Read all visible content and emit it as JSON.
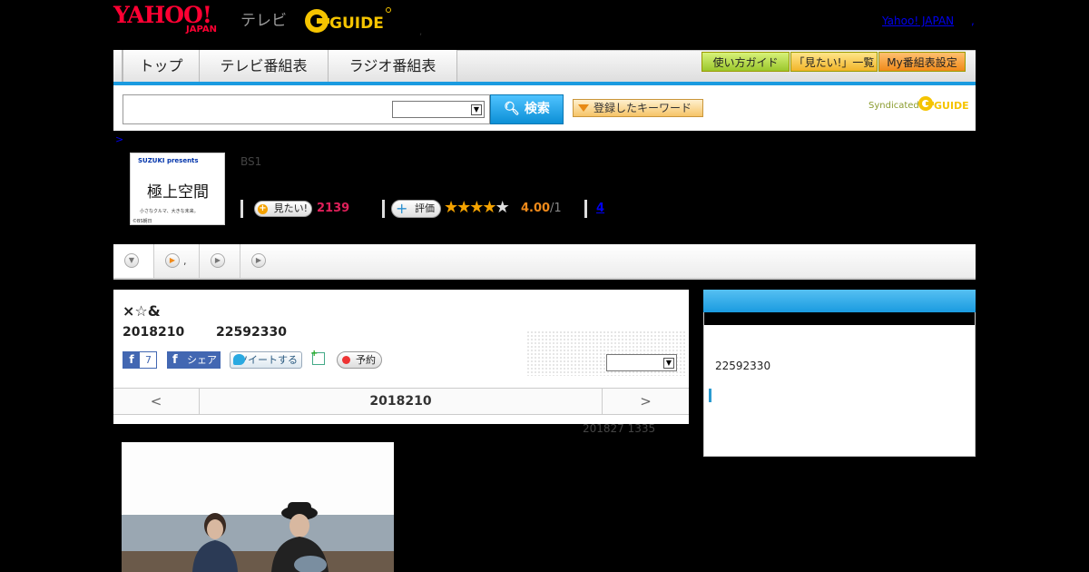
{
  "header": {
    "logo_yahoo": "YAHOO!",
    "logo_japan": "JAPAN",
    "logo_tv": "テレビ",
    "logo_gguide": "G GUIDE",
    "dot": ",",
    "yahoo_japan_link": "Yahoo! JAPAN",
    "sep": ","
  },
  "nav": {
    "tabs": [
      {
        "label": "トップ"
      },
      {
        "label": "テレビ番組表"
      },
      {
        "label": "ラジオ番組表"
      }
    ],
    "guide_buttons": [
      {
        "label": "使い方ガイド"
      },
      {
        "label": "「見たい!」一覧"
      },
      {
        "label": "My番組表設定"
      }
    ]
  },
  "search": {
    "placeholder": "",
    "button_label": "検索",
    "keyword_button_label": "登録したキーワード",
    "syndicated": "Syndicated"
  },
  "breadcrumb": ">",
  "program": {
    "thumb_brand": "SUZUKI presents",
    "thumb_title": "極上空間",
    "thumb_sub": "小さなクルマ、大きな未来。",
    "thumb_copyright": "©BS朝日",
    "channel": "BS1",
    "mitai_label": "見たい!",
    "mitai_count": "2139",
    "rate_label": "評価",
    "rating": 4.0,
    "rating_value": "4.00",
    "rating_count": "/1",
    "link_count": "4"
  },
  "subtabs": [
    {
      "label": ""
    },
    {
      "label": ","
    },
    {
      "label": ""
    },
    {
      "label": ""
    }
  ],
  "detail": {
    "title": "×☆&",
    "date": "2018210",
    "time": "22592330",
    "fb_like_count": "7",
    "fb_share_label": "シェア",
    "tweet_label": "ツイートする",
    "reserve_label": "予約",
    "prev": "<",
    "next": ">",
    "current_date": "2018210",
    "updated": "201827  1335"
  },
  "side": {
    "time": "22592330"
  },
  "colors": {
    "accent": "#1a9be0",
    "mitai": "#e0205a",
    "rating": "#f08a1a",
    "yahoo": "#ff0033"
  }
}
